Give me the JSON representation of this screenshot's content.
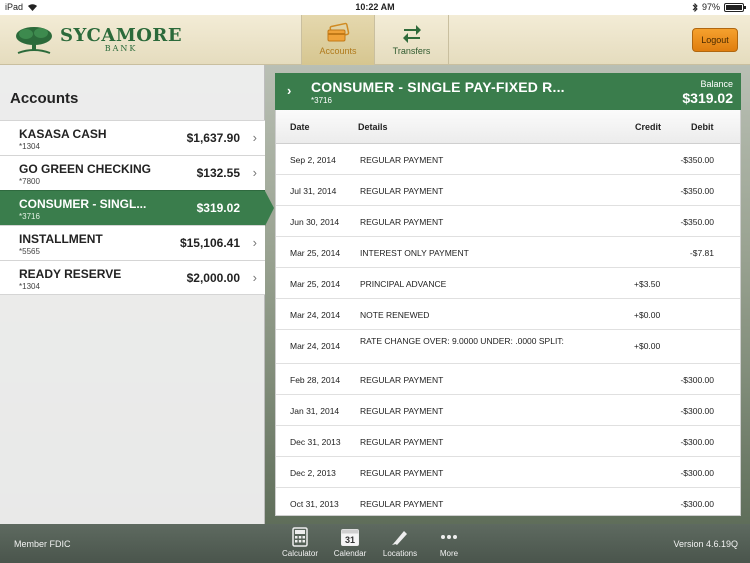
{
  "status": {
    "device": "iPad",
    "time": "10:22 AM",
    "battery": "97%",
    "battery_level": 0.97
  },
  "header": {
    "brand_name": "SYCAMORE",
    "brand_sub": "BANK",
    "tabs": [
      {
        "label": "Accounts",
        "active": true
      },
      {
        "label": "Transfers",
        "active": false
      }
    ],
    "logout_label": "Logout"
  },
  "accounts": {
    "title": "Accounts",
    "items": [
      {
        "name": "KASASA CASH",
        "number": "*1304",
        "balance": "$1,637.90"
      },
      {
        "name": "GO GREEN CHECKING",
        "number": "*7800",
        "balance": "$132.55"
      },
      {
        "name": "CONSUMER - SINGL...",
        "number": "*3716",
        "balance": "$319.02",
        "selected": true
      },
      {
        "name": "INSTALLMENT",
        "number": "*5565",
        "balance": "$15,106.41"
      },
      {
        "name": "READY RESERVE",
        "number": "*1304",
        "balance": "$2,000.00"
      }
    ]
  },
  "detail": {
    "title": "CONSUMER - SINGLE PAY-FIXED R...",
    "number": "*3716",
    "balance_label": "Balance",
    "balance": "$319.02",
    "columns": {
      "date": "Date",
      "details": "Details",
      "credit": "Credit",
      "debit": "Debit"
    },
    "transactions": [
      {
        "date": "Sep 2, 2014",
        "details": "REGULAR PAYMENT",
        "credit": "",
        "debit": "-$350.00"
      },
      {
        "date": "Jul 31, 2014",
        "details": "REGULAR PAYMENT",
        "credit": "",
        "debit": "-$350.00"
      },
      {
        "date": "Jun 30, 2014",
        "details": "REGULAR PAYMENT",
        "credit": "",
        "debit": "-$350.00"
      },
      {
        "date": "Mar 25, 2014",
        "details": "INTEREST ONLY PAYMENT",
        "credit": "",
        "debit": "-$7.81"
      },
      {
        "date": "Mar 25, 2014",
        "details": "PRINCIPAL ADVANCE",
        "credit": "+$3.50",
        "debit": ""
      },
      {
        "date": "Mar 24, 2014",
        "details": "NOTE RENEWED",
        "credit": "+$0.00",
        "debit": ""
      },
      {
        "date": "Mar 24, 2014",
        "details": "RATE CHANGE    OVER:  9.0000  UNDER:   .0000  SPLIT:",
        "credit": "+$0.00",
        "debit": ""
      },
      {
        "date": "Feb 28, 2014",
        "details": "REGULAR PAYMENT",
        "credit": "",
        "debit": "-$300.00"
      },
      {
        "date": "Jan 31, 2014",
        "details": "REGULAR PAYMENT",
        "credit": "",
        "debit": "-$300.00"
      },
      {
        "date": "Dec 31, 2013",
        "details": "REGULAR PAYMENT",
        "credit": "",
        "debit": "-$300.00"
      },
      {
        "date": "Dec 2, 2013",
        "details": "REGULAR PAYMENT",
        "credit": "",
        "debit": "-$300.00"
      },
      {
        "date": "Oct 31, 2013",
        "details": "REGULAR PAYMENT",
        "credit": "",
        "debit": "-$300.00"
      }
    ]
  },
  "footer": {
    "member": "Member FDIC",
    "version": "Version 4.6.19Q",
    "tools": [
      {
        "label": "Calculator",
        "icon": "calculator-icon"
      },
      {
        "label": "Calendar",
        "icon": "calendar-icon",
        "day": "31"
      },
      {
        "label": "Locations",
        "icon": "locations-icon"
      },
      {
        "label": "More",
        "icon": "more-icon"
      }
    ]
  },
  "colors": {
    "brand_green": "#3a7d4c",
    "accent_orange": "#e8891a",
    "tab_active": "#b07a1c"
  }
}
